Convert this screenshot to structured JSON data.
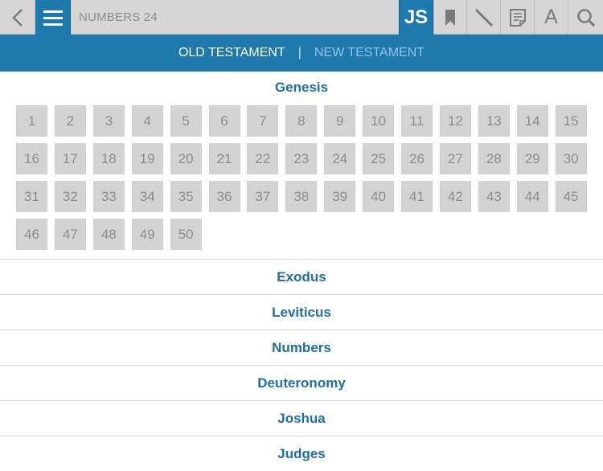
{
  "header": {
    "title": "NUMBERS 24",
    "js_label": "JS",
    "font_label": "A"
  },
  "tabs": {
    "old": "OLD TESTAMENT",
    "separator": "|",
    "new": "NEW TESTAMENT"
  },
  "expanded_book": {
    "name": "Genesis",
    "chapters": [
      "1",
      "2",
      "3",
      "4",
      "5",
      "6",
      "7",
      "8",
      "9",
      "10",
      "11",
      "12",
      "13",
      "14",
      "15",
      "16",
      "17",
      "18",
      "19",
      "20",
      "21",
      "22",
      "23",
      "24",
      "25",
      "26",
      "27",
      "28",
      "29",
      "30",
      "31",
      "32",
      "33",
      "34",
      "35",
      "36",
      "37",
      "38",
      "39",
      "40",
      "41",
      "42",
      "43",
      "44",
      "45",
      "46",
      "47",
      "48",
      "49",
      "50"
    ]
  },
  "books": [
    "Exodus",
    "Leviticus",
    "Numbers",
    "Deuteronomy",
    "Joshua",
    "Judges"
  ],
  "colors": {
    "accent": "#1f79ad",
    "book_text": "#1f6fa0",
    "chapter_bg": "#d3d3d3"
  }
}
